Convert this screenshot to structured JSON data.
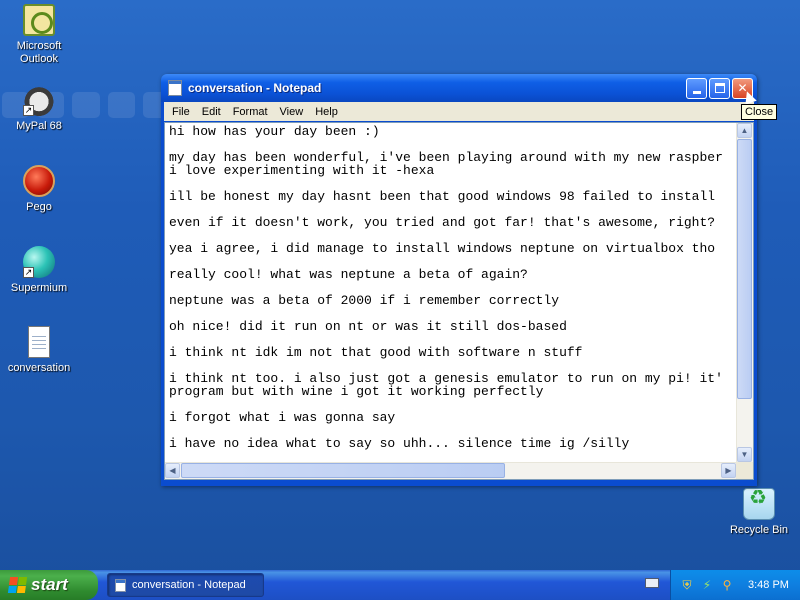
{
  "desktop": {
    "icons": [
      {
        "label": "Microsoft\nOutlook",
        "icon": "outlook-icon"
      },
      {
        "label": "MyPal 68",
        "icon": "mypal-icon"
      },
      {
        "label": "Pego",
        "icon": "pego-icon"
      },
      {
        "label": "Supermium",
        "icon": "supermium-icon"
      },
      {
        "label": "conversation",
        "icon": "text-document-icon"
      },
      {
        "label": "Recycle Bin",
        "icon": "recycle-bin-icon"
      }
    ]
  },
  "window": {
    "title": "conversation - Notepad",
    "menu": [
      "File",
      "Edit",
      "Format",
      "View",
      "Help"
    ],
    "close_tooltip": "Close",
    "lines": [
      "hi how has your day been :)",
      "",
      "my day has been wonderful, i've been playing around with my new raspber",
      "i love experimenting with it -hexa",
      "",
      "ill be honest my day hasnt been that good windows 98 failed to install",
      "",
      "even if it doesn't work, you tried and got far! that's awesome, right?",
      "",
      "yea i agree, i did manage to install windows neptune on virtualbox tho",
      "",
      "really cool! what was neptune a beta of again?",
      "",
      "neptune was a beta of 2000 if i remember correctly",
      "",
      "oh nice! did it run on nt or was it still dos-based",
      "",
      "i think nt idk im not that good with software n stuff",
      "",
      "i think nt too. i also just got a genesis emulator to run on my pi! it'",
      "program but with wine i got it working perfectly",
      "",
      "i forgot what i was gonna say",
      "",
      "i have no idea what to say so uhh... silence time ig /silly"
    ]
  },
  "taskbar": {
    "start_label": "start",
    "task_button": "conversation - Notepad",
    "clock": "3:48 PM"
  },
  "colors": {
    "desktop": "#1f5cb8",
    "titlebar": "#0b52d6",
    "close_button": "#d84323",
    "start_button": "#3c9a3c"
  }
}
